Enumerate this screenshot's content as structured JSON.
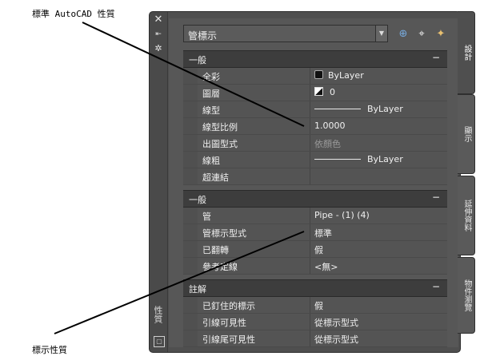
{
  "callouts": {
    "top": "標準 AutoCAD 性質",
    "bottom": "標示性質"
  },
  "palette": {
    "title": "性質",
    "titlebar_icons": [
      "close-icon",
      "pin-icon",
      "settings-icon"
    ],
    "dropdown_value": "管標示",
    "tools": [
      "add-selection-icon",
      "select-objects-icon",
      "quick-select-icon"
    ],
    "sections": [
      {
        "title": "一般",
        "collapse": "−",
        "rows": [
          {
            "label": "全彩",
            "value": "ByLayer",
            "swatch": "color"
          },
          {
            "label": "圖層",
            "value": "0",
            "swatch": "layer"
          },
          {
            "label": "線型",
            "value": "ByLayer",
            "swatch": "line"
          },
          {
            "label": "線型比例",
            "value": "1.0000"
          },
          {
            "label": "出圖型式",
            "value": "依顏色",
            "dim": true
          },
          {
            "label": "線粗",
            "value": "ByLayer",
            "swatch": "line"
          },
          {
            "label": "超連結",
            "value": ""
          }
        ]
      },
      {
        "title": "一般",
        "collapse": "−",
        "rows": [
          {
            "label": "管",
            "value": "Pipe - (1) (4)"
          },
          {
            "label": "管標示型式",
            "value": "標準"
          },
          {
            "label": "已翻轉",
            "value": "假"
          },
          {
            "label": "參考定線",
            "value": "<無>"
          }
        ]
      },
      {
        "title": "註解",
        "collapse": "−",
        "rows": [
          {
            "label": "已釘住的標示",
            "value": "假"
          },
          {
            "label": "引線可見性",
            "value": "從標示型式"
          },
          {
            "label": "引線尾可見性",
            "value": "從標示型式"
          }
        ]
      }
    ],
    "side_tabs": [
      "設計",
      "顯示",
      "延伸資料",
      "物件瀏覽"
    ]
  }
}
